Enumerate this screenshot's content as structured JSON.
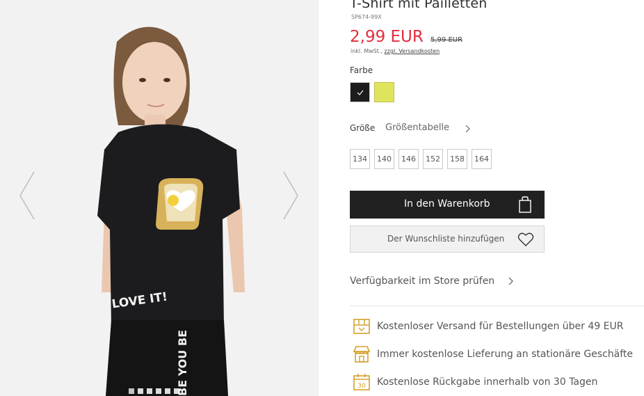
{
  "product": {
    "title": "T-Shirt mit Pailletten",
    "sku": "SP674-99X",
    "price_current": "2,99 EUR",
    "price_old": "5,99 EUR",
    "tax_prefix": "inkl. MwSt., ",
    "tax_link": "zzgl. Versandkosten"
  },
  "colors": {
    "label": "Farbe",
    "options": [
      {
        "name": "black",
        "hex": "#1c1c1c",
        "selected": true
      },
      {
        "name": "yellow",
        "hex": "#dfe45f",
        "selected": false
      }
    ]
  },
  "size": {
    "label": "Größe",
    "table_link": "Größentabelle",
    "options": [
      "134",
      "140",
      "146",
      "152",
      "158",
      "164"
    ]
  },
  "actions": {
    "cart_label": "In den Warenkorb",
    "wishlist_label": "Der Wunschliste hinzufügen",
    "store_check": "Verfügbarkeit im Store prüfen"
  },
  "benefits": [
    {
      "icon": "shipping-box-icon",
      "text": "Kostenloser Versand für Bestellungen über 49 EUR"
    },
    {
      "icon": "store-icon",
      "text": "Immer kostenlose Lieferung an stationäre Geschäfte"
    },
    {
      "icon": "calendar-30-icon",
      "text": "Kostenlose Rückgabe innerhalb von 30 Tagen"
    }
  ],
  "gallery": {
    "image_count": 6,
    "active_index": 0,
    "print_text": "LOVE IT!",
    "leg_print_text": "BE YOU BE"
  },
  "theme": {
    "accent_price": "#e42d3e",
    "button_dark": "#212121",
    "icon_gold": "#d4a12a"
  }
}
